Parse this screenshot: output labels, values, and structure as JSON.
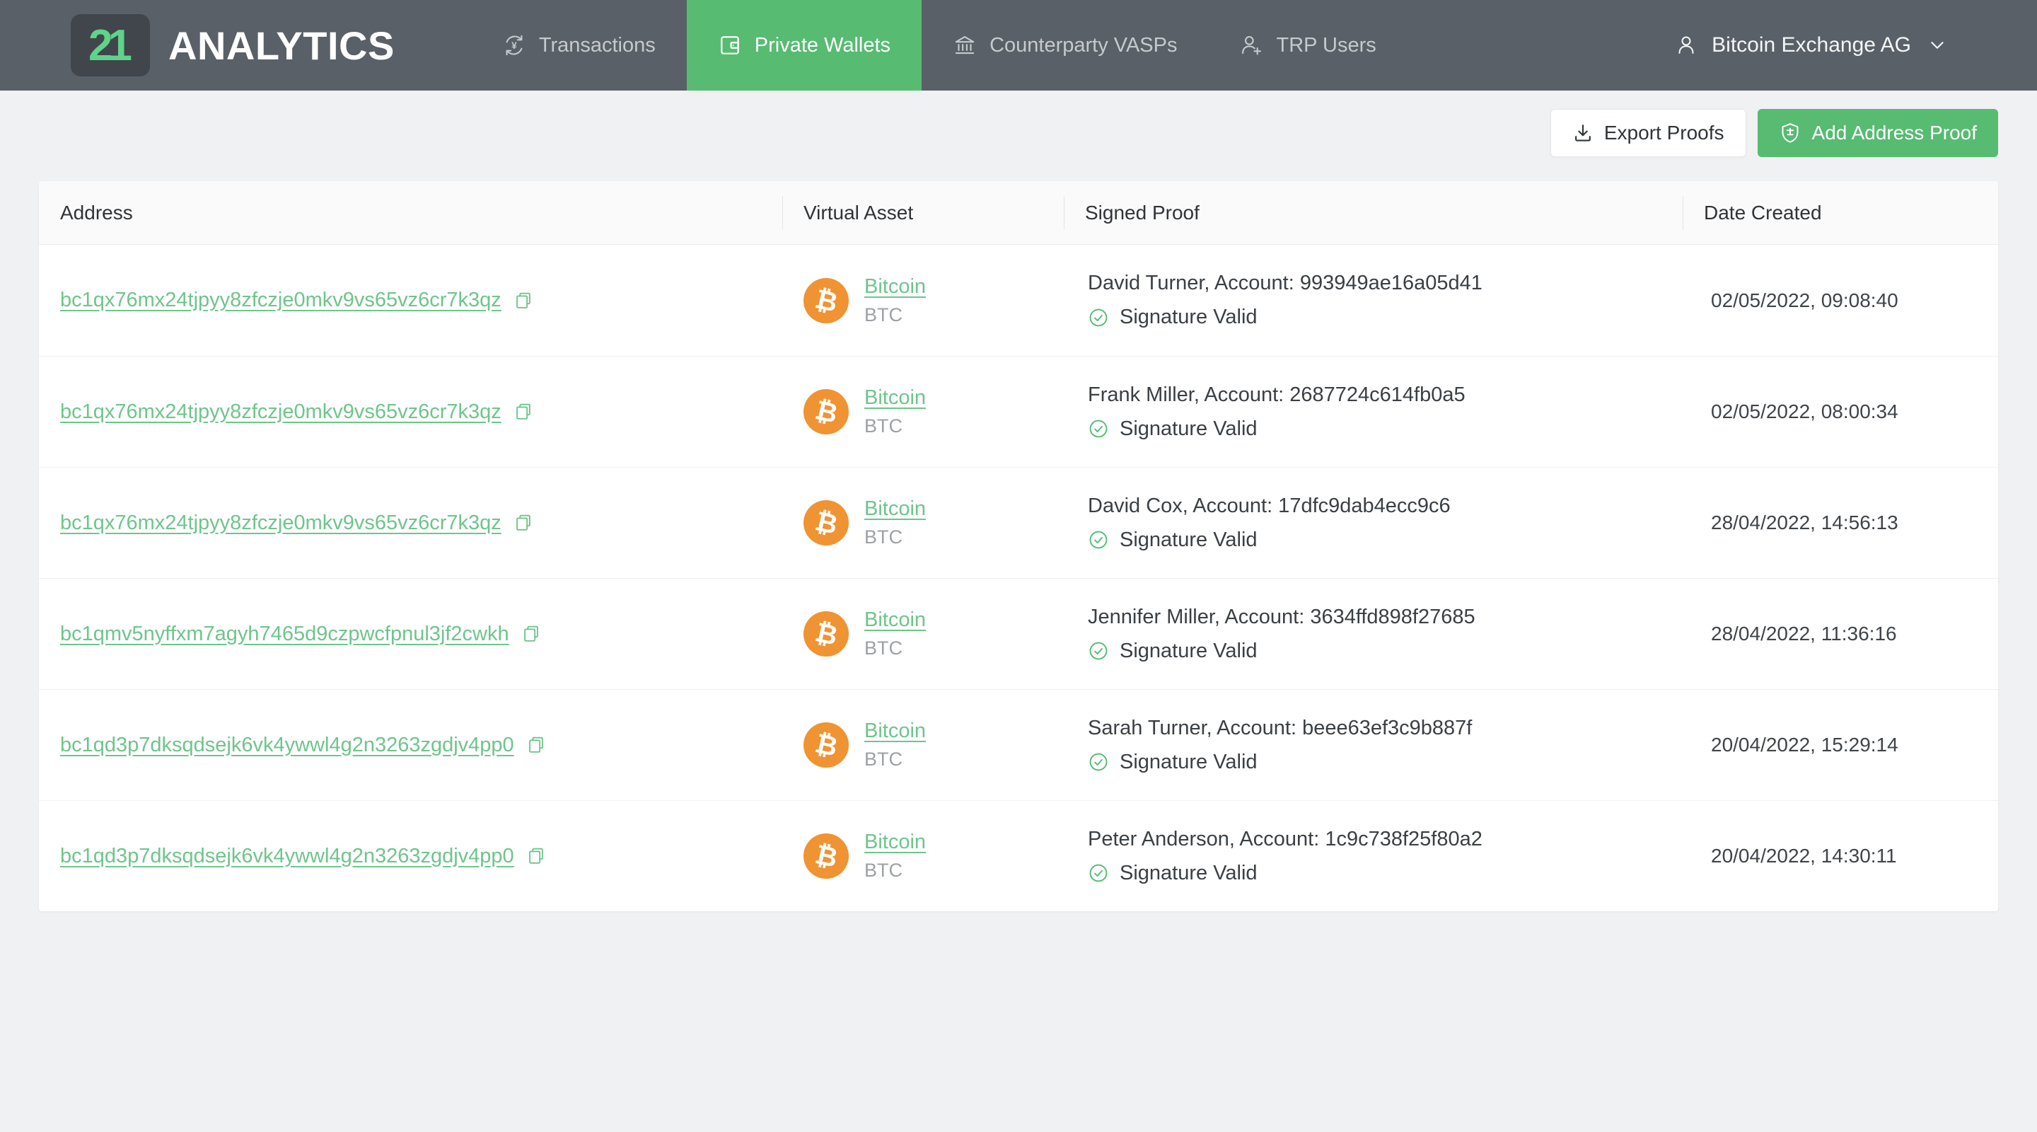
{
  "brand": {
    "badge": "21",
    "name": "ANALYTICS"
  },
  "nav": {
    "tabs": [
      {
        "label": "Transactions",
        "icon": "currency-exchange-icon",
        "active": false
      },
      {
        "label": "Private Wallets",
        "icon": "wallet-icon",
        "active": true
      },
      {
        "label": "Counterparty VASPs",
        "icon": "bank-icon",
        "active": false
      },
      {
        "label": "TRP Users",
        "icon": "user-plus-icon",
        "active": false
      }
    ],
    "user_menu": {
      "label": "Bitcoin Exchange AG",
      "icon": "person-icon",
      "chevron": "chevron-down-icon"
    }
  },
  "toolbar": {
    "export_label": "Export Proofs",
    "add_label": "Add Address Proof"
  },
  "table": {
    "columns": [
      "Address",
      "Virtual Asset",
      "Signed Proof",
      "Date Created"
    ],
    "rows": [
      {
        "address": "bc1qx76mx24tjpyy8zfczje0mkv9vs65vz6cr7k3qz",
        "asset_name": "Bitcoin",
        "asset_ticker": "BTC",
        "proof": "David Turner, Account: 993949ae16a05d41",
        "status": "Signature Valid",
        "date": "02/05/2022, 09:08:40"
      },
      {
        "address": "bc1qx76mx24tjpyy8zfczje0mkv9vs65vz6cr7k3qz",
        "asset_name": "Bitcoin",
        "asset_ticker": "BTC",
        "proof": "Frank Miller, Account: 2687724c614fb0a5",
        "status": "Signature Valid",
        "date": "02/05/2022, 08:00:34"
      },
      {
        "address": "bc1qx76mx24tjpyy8zfczje0mkv9vs65vz6cr7k3qz",
        "asset_name": "Bitcoin",
        "asset_ticker": "BTC",
        "proof": "David Cox, Account: 17dfc9dab4ecc9c6",
        "status": "Signature Valid",
        "date": "28/04/2022, 14:56:13"
      },
      {
        "address": "bc1qmv5nyffxm7agyh7465d9czpwcfpnul3jf2cwkh",
        "asset_name": "Bitcoin",
        "asset_ticker": "BTC",
        "proof": "Jennifer Miller, Account: 3634ffd898f27685",
        "status": "Signature Valid",
        "date": "28/04/2022, 11:36:16"
      },
      {
        "address": "bc1qd3p7dksqdsejk6vk4ywwl4g2n3263zgdjv4pp0",
        "asset_name": "Bitcoin",
        "asset_ticker": "BTC",
        "proof": "Sarah Turner, Account: beee63ef3c9b887f",
        "status": "Signature Valid",
        "date": "20/04/2022, 15:29:14"
      },
      {
        "address": "bc1qd3p7dksqdsejk6vk4ywwl4g2n3263zgdjv4pp0",
        "asset_name": "Bitcoin",
        "asset_ticker": "BTC",
        "proof": "Peter Anderson, Account: 1c9c738f25f80a2",
        "status": "Signature Valid",
        "date": "20/04/2022, 14:30:11"
      }
    ]
  },
  "colors": {
    "nav_bg": "#596067",
    "brand_green": "#57bb72",
    "logo_green": "#5fd38a",
    "link_green": "#6ec58b",
    "status_green": "#52bb72",
    "bitcoin_orange": "#f09332",
    "page_bg": "#eff1f2"
  }
}
